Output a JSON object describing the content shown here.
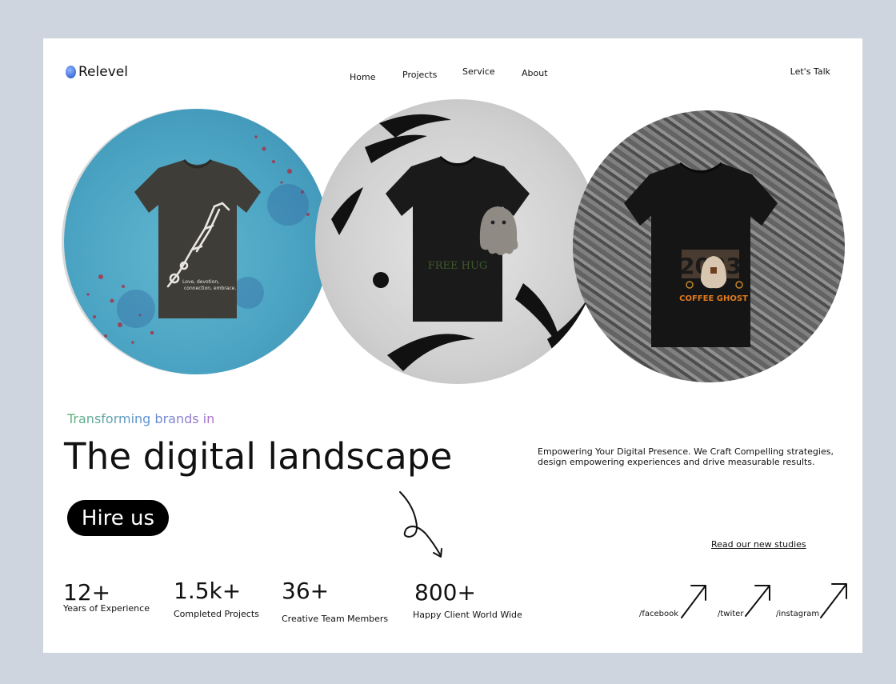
{
  "brand": {
    "name": "Relevel"
  },
  "nav": {
    "items": [
      "Home",
      "Projects",
      "Service",
      "About"
    ],
    "cta": "Let's Talk"
  },
  "hero_images": [
    {
      "icon": "skeleton-hand-tshirt-image",
      "shirt_text": "Love, devotion,\nconnection, embrace."
    },
    {
      "icon": "ghost-tshirt-image",
      "shirt_text": "FREE HUG"
    },
    {
      "icon": "coffee-ghost-tshirt-image",
      "shirt_text": "COFFEE GHOST",
      "shirt_year": "2023"
    }
  ],
  "hero": {
    "tagline": "Transforming brands in",
    "headline": "The digital landscape",
    "description": "Empowering Your Digital Presence. We Craft Compelling strategies, design empowering experiences and drive measurable results.",
    "cta": "Hire us"
  },
  "studies_link": "Read our new studies",
  "stats": [
    {
      "value": "12+",
      "label": "Years of Experience"
    },
    {
      "value": "1.5k+",
      "label": "Completed Projects"
    },
    {
      "value": "36+",
      "label": "Creative Team Members"
    },
    {
      "value": "800+",
      "label": "Happy Client World Wide"
    }
  ],
  "social": [
    {
      "label": "/facebook",
      "icon": "arrow-up-right-icon"
    },
    {
      "label": "/twiter",
      "icon": "arrow-up-right-icon"
    },
    {
      "label": "/instagram",
      "icon": "arrow-up-right-icon"
    }
  ],
  "colors": {
    "background": "#cfd5de",
    "page": "#ffffff",
    "button": "#000000",
    "tagline_gradient": [
      "#5fb37a",
      "#5b8fd6",
      "#b06fc8"
    ]
  }
}
